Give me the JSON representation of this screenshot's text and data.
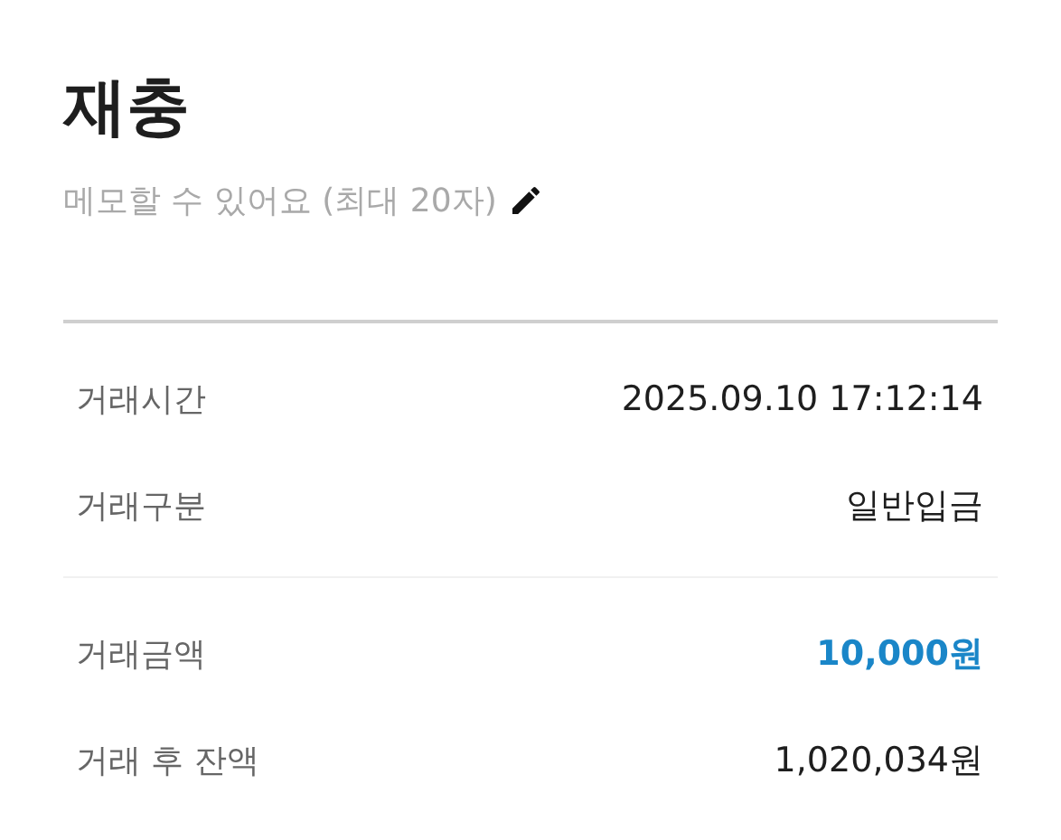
{
  "title": "재충",
  "memo": {
    "placeholder": "메모할 수 있어요 (최대 20자)"
  },
  "sections": [
    {
      "rows": [
        {
          "label": "거래시간",
          "value": "2025.09.10 17:12:14",
          "kind": "plain"
        },
        {
          "label": "거래구분",
          "value": "일반입금",
          "kind": "plain"
        }
      ]
    },
    {
      "rows": [
        {
          "label": "거래금액",
          "value": "10,000원",
          "kind": "highlight"
        },
        {
          "label": "거래 후 잔액",
          "value": "1,020,034원",
          "kind": "plain"
        }
      ]
    }
  ]
}
